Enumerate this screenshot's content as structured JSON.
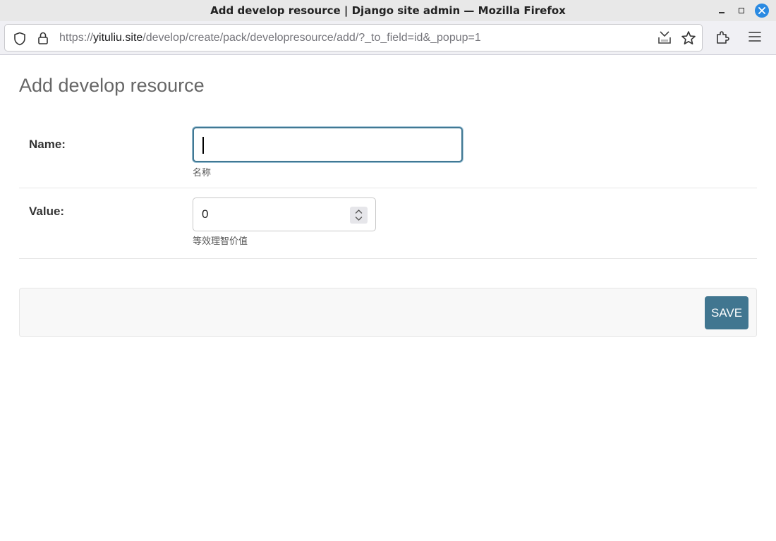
{
  "window": {
    "title": "Add develop resource | Django site admin — Mozilla Firefox",
    "controls": [
      "minimize-icon",
      "maximize-icon",
      "close-icon"
    ]
  },
  "browser": {
    "url_prefix": "https://",
    "url_host": "yituliu.site",
    "url_path": "/develop/create/pack/developresource/add/?_to_field=id&_popup=1"
  },
  "page": {
    "title": "Add develop resource"
  },
  "form": {
    "name_label": "Name:",
    "name_value": "",
    "name_help": "名称",
    "value_label": "Value:",
    "value_value": "0",
    "value_help": "等效理智价值",
    "save_label": "SAVE"
  },
  "colors": {
    "accent": "#417690",
    "focus_border": "#417893",
    "close_button": "#2a8ae2"
  }
}
